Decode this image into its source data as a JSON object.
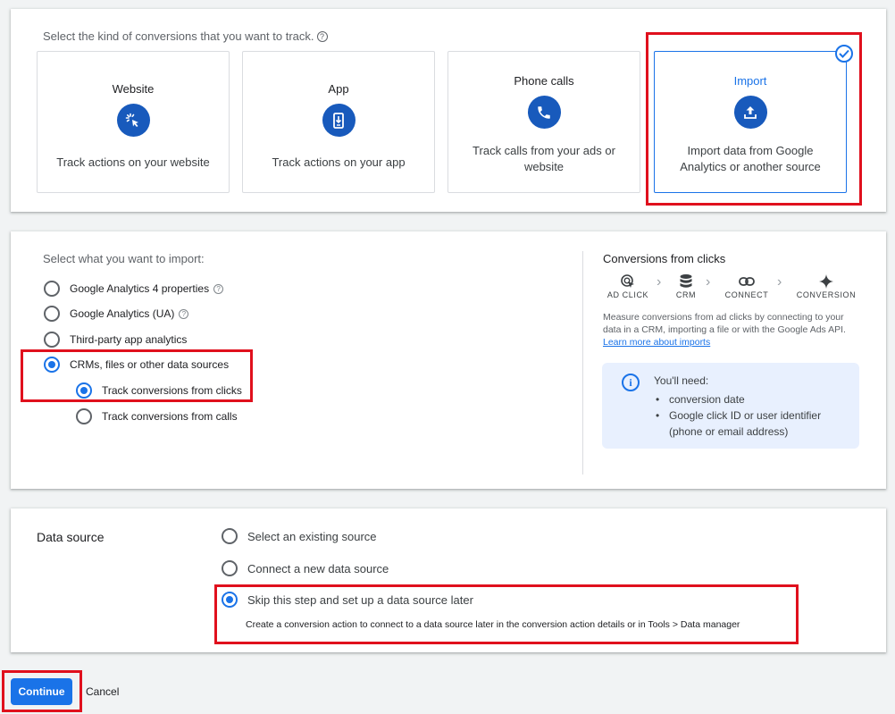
{
  "conversion_kind": {
    "prompt": "Select the kind of conversions that you want to track.",
    "help_icon": "help-circle-icon",
    "tiles": [
      {
        "title": "Website",
        "icon": "cursor-click-icon",
        "description": "Track actions on your website"
      },
      {
        "title": "App",
        "icon": "mobile-app-icon",
        "description": "Track actions on your app"
      },
      {
        "title": "Phone calls",
        "icon": "phone-icon",
        "description": "Track calls from your ads or website"
      },
      {
        "title": "Import",
        "icon": "upload-icon",
        "description": "Import data from Google Analytics or another source",
        "selected": true
      }
    ]
  },
  "import_source": {
    "prompt": "Select what you want to import:",
    "options": [
      {
        "label": "Google Analytics 4 properties",
        "selected": false,
        "help": true
      },
      {
        "label": "Google Analytics (UA)",
        "selected": false,
        "help": true
      },
      {
        "label": "Third-party app analytics",
        "selected": false
      },
      {
        "label": "CRMs, files or other data sources",
        "selected": true
      },
      {
        "label": "Track conversions from clicks",
        "selected": true
      },
      {
        "label": "Track conversions from calls",
        "selected": false
      }
    ],
    "side_panel": {
      "title": "Conversions from clicks",
      "flow": [
        {
          "label": "AD CLICK",
          "icon": "ad-click-icon"
        },
        {
          "label": "CRM",
          "icon": "database-icon"
        },
        {
          "label": "CONNECT",
          "icon": "link-icon"
        },
        {
          "label": "CONVERSION",
          "icon": "sparkle-icon"
        }
      ],
      "description": "Measure conversions from ad clicks by connecting to your data in a CRM, importing a file or with the Google Ads API.",
      "link": "Learn more about imports",
      "need_title": "You'll need:",
      "needs": [
        "conversion date",
        "Google click ID or user identifier (phone or email address)"
      ]
    }
  },
  "data_source": {
    "label": "Data source",
    "options": [
      {
        "label": "Select an existing source",
        "selected": false
      },
      {
        "label": "Connect a new data source",
        "selected": false
      },
      {
        "label": "Skip this step and set up a data source later",
        "selected": true
      }
    ],
    "skip_hint": "Create a conversion action to connect to a data source later in the conversion action details or in Tools > Data manager"
  },
  "actions": {
    "continue": "Continue",
    "cancel": "Cancel"
  },
  "colors": {
    "accent": "#1a73e8",
    "highlight": "#e0101d",
    "icon_bg": "#185abc"
  }
}
